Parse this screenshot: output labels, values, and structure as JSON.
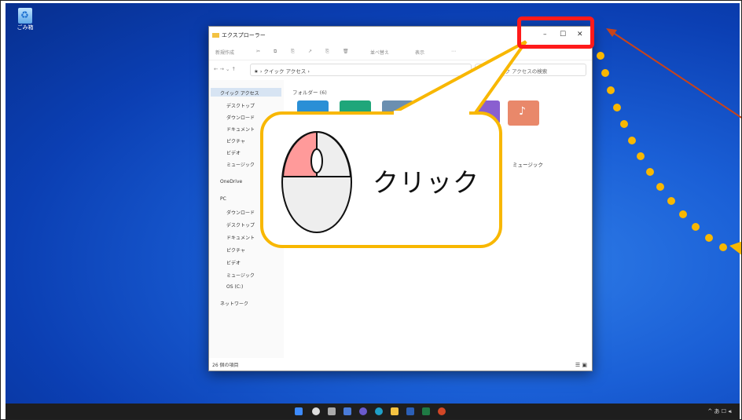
{
  "window": {
    "title": "エクスプローラー",
    "minimize_glyph": "–",
    "maximize_glyph": "☐",
    "close_glyph": "✕",
    "toolbar": [
      "新規作成",
      "✂",
      "⧉",
      "⎘",
      "↗",
      "⎘",
      "🗑",
      "並べ替え",
      "表示",
      "⋯"
    ],
    "address": "★ › クイック アクセス ›",
    "search_placeholder": "クイック アクセスの検索",
    "folders_header": "フォルダー (6)",
    "music_label": "ミュージック",
    "status": "26 個の項目"
  },
  "nav": {
    "items": [
      "クイック アクセス",
      "デスクトップ",
      "ダウンロード",
      "ドキュメント",
      "ピクチャ",
      "ビデオ",
      "ミュージック",
      "OneDrive",
      "PC",
      "ダウンロード",
      "デスクトップ",
      "ドキュメント",
      "ピクチャ",
      "ビデオ",
      "ミュージック",
      "OS (C:)",
      "ネットワーク"
    ]
  },
  "desktop": {
    "recycle_label": "ごみ箱"
  },
  "callout": {
    "text": "クリック"
  },
  "taskbar": {
    "tray": "^ あ ☐ ◂ᵢ"
  },
  "colors": {
    "accent_red": "#ff1a1a",
    "callout_yellow": "#f8b700",
    "mouse_pink": "#ff9a9a"
  }
}
